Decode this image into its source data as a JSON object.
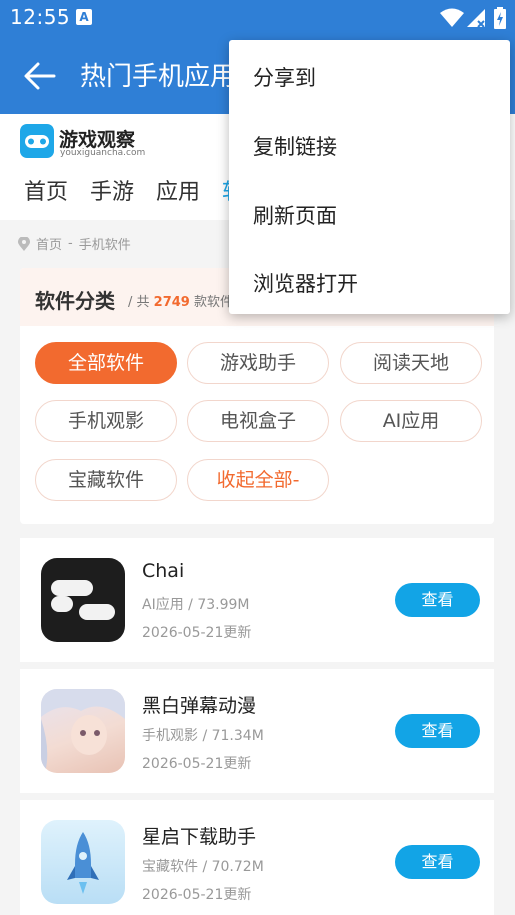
{
  "statusbar": {
    "time": "12:55",
    "notif_letter": "A"
  },
  "appbar": {
    "title": "热门手机应用"
  },
  "site": {
    "logo_name": "游戏观察",
    "logo_domain": "youxiguancha.com",
    "nav": [
      "首页",
      "手游",
      "应用",
      "软"
    ]
  },
  "breadcrumb": {
    "home": "首页",
    "sep": "-",
    "current": "手机软件"
  },
  "category": {
    "title": "软件分类",
    "prefix": "/ 共",
    "count": "2749",
    "suffix": "款软件",
    "tags": [
      "全部软件",
      "游戏助手",
      "阅读天地",
      "手机观影",
      "电视盒子",
      "AI应用",
      "宝藏软件",
      "收起全部-"
    ]
  },
  "apps": [
    {
      "name": "Chai",
      "meta": "AI应用 / 73.99M",
      "date": "2026-05-21更新",
      "button": "查看"
    },
    {
      "name": "黑白弹幕动漫",
      "meta": "手机观影 / 71.34M",
      "date": "2026-05-21更新",
      "button": "查看"
    },
    {
      "name": "星启下载助手",
      "meta": "宝藏软件 / 70.72M",
      "date": "2026-05-21更新",
      "button": "查看"
    }
  ],
  "menu": {
    "items": [
      "分享到",
      "复制链接",
      "刷新页面",
      "浏览器打开"
    ]
  },
  "colors": {
    "primary": "#2f7fd6",
    "accent": "#f26a2f",
    "button": "#12a4e6"
  }
}
